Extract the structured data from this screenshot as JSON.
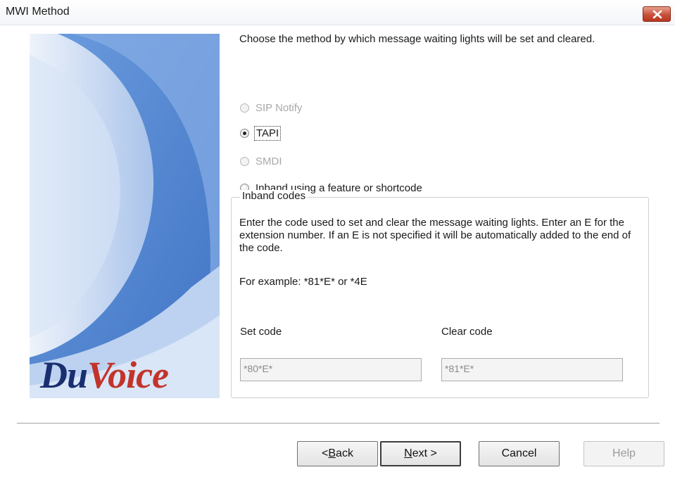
{
  "window": {
    "title": "MWI Method",
    "close_icon": "close-icon"
  },
  "banner": {
    "logo_part1": "Du",
    "logo_part2": "Voice",
    "colors": {
      "brand_blue": "#1a2f70",
      "brand_red": "#c2342b"
    }
  },
  "intro_text": "Choose the method by which message waiting lights will be set and cleared.",
  "options": [
    {
      "label": "SIP Notify",
      "checked": false,
      "enabled": false
    },
    {
      "label": "TAPI",
      "checked": true,
      "enabled": true
    },
    {
      "label": "SMDI",
      "checked": false,
      "enabled": false
    },
    {
      "label": "Inband using a feature or shortcode",
      "checked": false,
      "enabled": true
    }
  ],
  "inband": {
    "legend": "Inband codes",
    "description": "Enter the code used to set and clear the message waiting lights.  Enter an E for the extension number.  If an E is not specified it will be automatically added to the end of the code.",
    "example": "For example: *81*E* or *4E",
    "set_code": {
      "label": "Set code",
      "value": "*80*E*"
    },
    "clear_code": {
      "label": "Clear code",
      "value": "*81*E*"
    }
  },
  "buttons": {
    "back": {
      "prefix": "< ",
      "mnemonic": "B",
      "rest": "ack"
    },
    "next": {
      "mnemonic": "N",
      "rest": "ext >"
    },
    "cancel": "Cancel",
    "help": "Help"
  }
}
